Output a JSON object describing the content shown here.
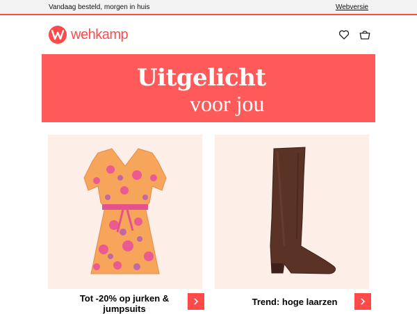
{
  "topbar": {
    "tagline": "Vandaag besteld, morgen in huis",
    "web_version": "Webversie"
  },
  "header": {
    "logo_text": "wehkamp",
    "icons": [
      "heart-icon",
      "shopping-bag-icon"
    ]
  },
  "banner": {
    "line1": "Uitgelicht",
    "line2": "voor jou"
  },
  "cards": [
    {
      "caption": "Tot -20% op jurken & jumpsuits",
      "image": "floral-dress-image",
      "button_icon": "chevron-right-icon"
    },
    {
      "caption": "Trend: hoge laarzen",
      "image": "knee-high-boot-image",
      "button_icon": "chevron-right-icon"
    }
  ],
  "colors": {
    "accent": "#ff4a4a",
    "banner": "#ff5a5a",
    "card_bg": "#fdeee7",
    "topbar_bg": "#f3f3f3"
  }
}
